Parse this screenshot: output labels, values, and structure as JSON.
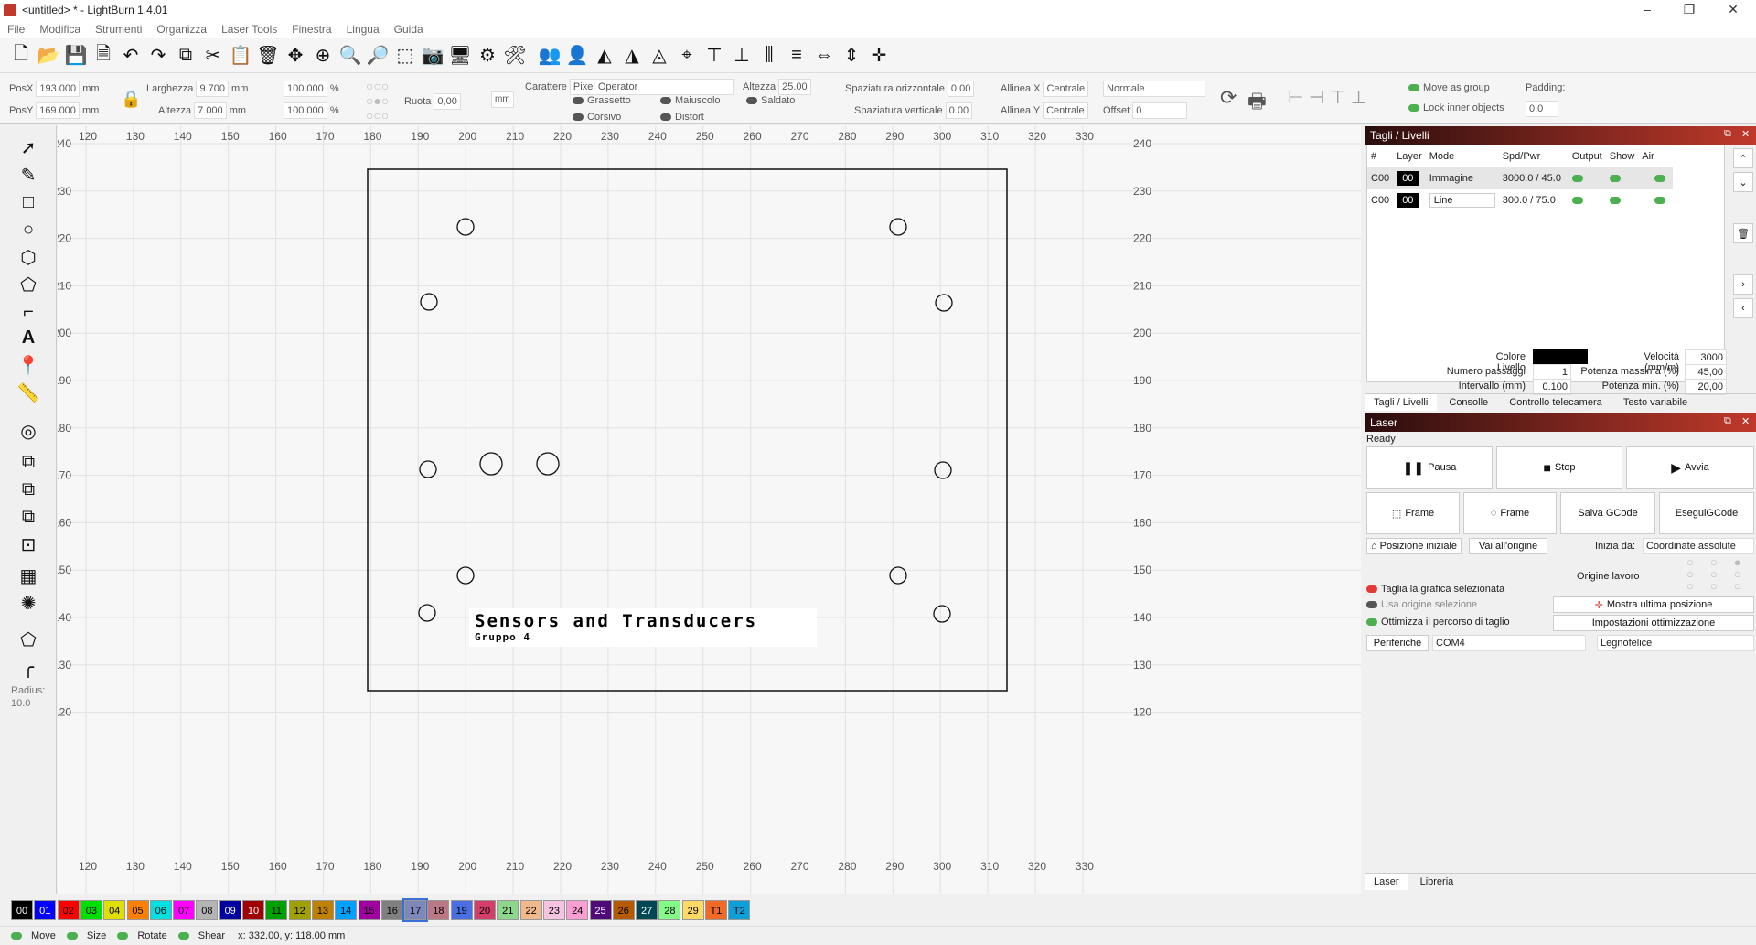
{
  "window": {
    "title": "<untitled> * - LightBurn 1.4.01"
  },
  "menu": [
    "File",
    "Modifica",
    "Strumenti",
    "Organizza",
    "Laser Tools",
    "Finestra",
    "Lingua",
    "Guida"
  ],
  "toolbar2": {
    "posx_label": "PosX",
    "posx": "193.000",
    "posy_label": "PosY",
    "posy": "169.000",
    "unit": "mm",
    "width_label": "Larghezza",
    "width": "9.700",
    "height_label": "Altezza",
    "height": "7.000",
    "scale_x": "100.000",
    "scale_y": "100.000",
    "pct": "%",
    "rotate_label": "Ruota",
    "rotate": "0,00",
    "mm_btn": "mm",
    "font_label": "Carattere",
    "font": "Pixel Operator",
    "bold": "Grassetto",
    "italic": "Corsivo",
    "upper": "Maiuscolo",
    "distort": "Distort",
    "welded": "Saldato",
    "text_h_label": "Altezza",
    "text_h": "25.00",
    "hspace_label": "Spaziatura orizzontale",
    "hspace": "0.00",
    "vspace_label": "Spaziatura verticale",
    "vspace": "0.00",
    "alignx_label": "Allinea X",
    "alignx": "Centrale",
    "aligny_label": "Allinea Y",
    "aligny": "Centrale",
    "normal": "Normale",
    "offset_label": "Offset",
    "offset": "0",
    "move_group": "Move as group",
    "lock_inner": "Lock inner objects",
    "padding_label": "Padding:",
    "padding": "0.0"
  },
  "left_tools": {
    "radius_label": "Radius:",
    "radius": "10.0"
  },
  "ruler": {
    "x": [
      "120",
      "130",
      "140",
      "150",
      "160",
      "170",
      "180",
      "190",
      "200",
      "210",
      "220",
      "230",
      "240",
      "250",
      "260",
      "270",
      "280",
      "290",
      "300",
      "310",
      "320",
      "330"
    ],
    "y": [
      "240",
      "230",
      "220",
      "210",
      "200",
      "190",
      "180",
      "170",
      "160",
      "150",
      "140",
      "130",
      "120"
    ]
  },
  "design": {
    "title": "Sensors and Transducers",
    "subtitle": "Gruppo 4"
  },
  "layers_panel": {
    "title": "Tagli / Livelli",
    "headers": [
      "#",
      "Layer",
      "Mode",
      "Spd/Pwr",
      "Output",
      "Show",
      "Air"
    ],
    "rows": [
      {
        "id": "C00",
        "layer": "00",
        "mode": "Immagine",
        "spdpwr": "3000.0 / 45.0"
      },
      {
        "id": "C00",
        "layer": "00",
        "mode": "Line",
        "spdpwr": "300.0 / 75.0"
      }
    ],
    "color_label": "Colore Livello",
    "speed_label": "Velocità (mm/m)",
    "speed": "3000",
    "passes_label": "Numero passaggi",
    "passes": "1",
    "maxpow_label": "Potenza massima (%)",
    "maxpow": "45,00",
    "interval_label": "Intervallo (mm)",
    "interval": "0.100",
    "minpow_label": "Potenza min. (%)",
    "minpow": "20,00",
    "tabs": [
      "Tagli / Livelli",
      "Consolle",
      "Controllo telecamera",
      "Testo variabile"
    ]
  },
  "laser_panel": {
    "title": "Laser",
    "status": "Ready",
    "pause": "Pausa",
    "stop": "Stop",
    "start": "Avvia",
    "frame1": "Frame",
    "frame2": "Frame",
    "save_gcode": "Salva GCode",
    "run_gcode": "EseguiGCode",
    "home": "Posizione iniziale",
    "goto_origin": "Vai all'origine",
    "start_from_label": "Inizia da:",
    "start_from": "Coordinate assolute",
    "job_origin": "Origine lavoro",
    "cut_selected": "Taglia la grafica selezionata",
    "use_selection_origin": "Usa origine selezione",
    "optimize": "Ottimizza il percorso di taglio",
    "show_last": "Mostra ultima posizione",
    "opt_settings": "Impostazioni ottimizzazione",
    "devices": "Periferiche",
    "port": "COM4",
    "device": "Legnofelice",
    "tabs": [
      "Laser",
      "Libreria"
    ]
  },
  "palette": [
    "00",
    "01",
    "02",
    "03",
    "04",
    "05",
    "06",
    "07",
    "08",
    "09",
    "10",
    "11",
    "12",
    "13",
    "14",
    "15",
    "16",
    "17",
    "18",
    "19",
    "20",
    "21",
    "22",
    "23",
    "24",
    "25",
    "26",
    "27",
    "28",
    "29",
    "T1",
    "T2"
  ],
  "palette_colors": [
    "#000000",
    "#0000ff",
    "#ff0000",
    "#00e000",
    "#e0e000",
    "#ff8000",
    "#00e0e0",
    "#ff00ff",
    "#b4b4b4",
    "#0000a0",
    "#a00000",
    "#00a000",
    "#a0a000",
    "#c08000",
    "#00a0ff",
    "#a000a0",
    "#808080",
    "#7d87b9",
    "#bb7784",
    "#4a6fe3",
    "#d33f6a",
    "#8cd78c",
    "#f0b98d",
    "#f6c4e1",
    "#fa9ed4",
    "#500a78",
    "#b45a00",
    "#004754",
    "#86fa88",
    "#ffdb66",
    "#f36926",
    "#0ca0d9"
  ],
  "status": {
    "move": "Move",
    "size": "Size",
    "rotate": "Rotate",
    "shear": "Shear",
    "coords": "x: 332.00, y: 118.00 mm"
  }
}
